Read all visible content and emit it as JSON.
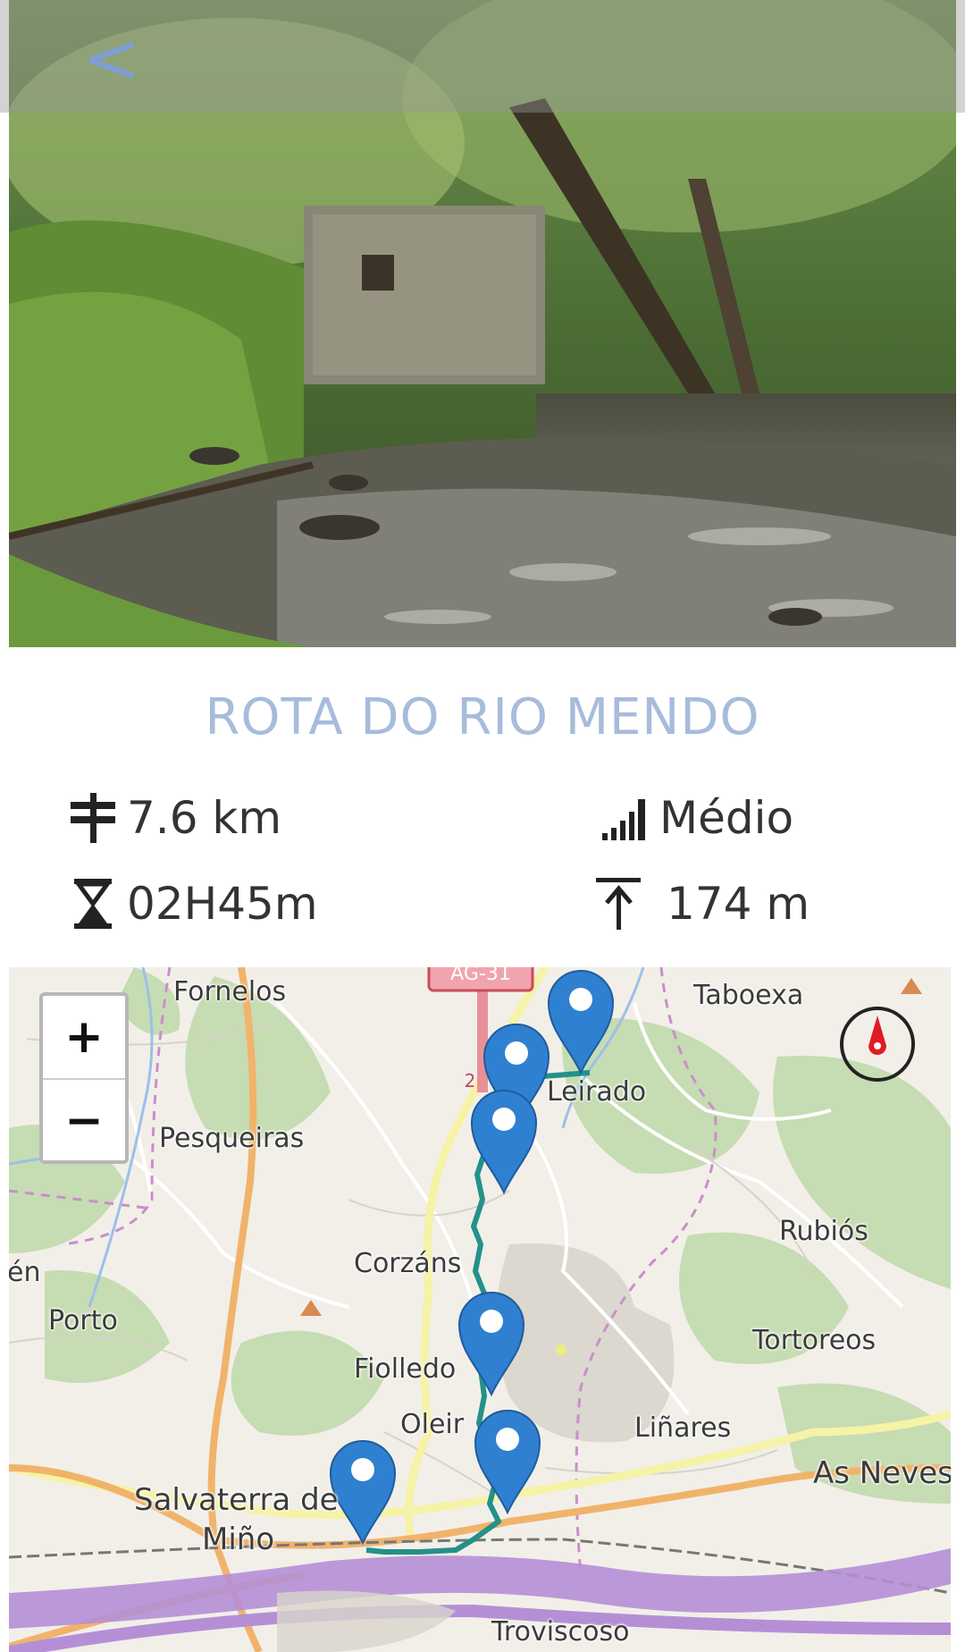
{
  "header": {
    "back_label": "<"
  },
  "route": {
    "title": "ROTA DO RIO MENDO",
    "distance": "7.6 km",
    "difficulty": "Médio",
    "duration": "02H45m",
    "elevation": "174 m"
  },
  "icons": {
    "distance": "signpost-icon",
    "difficulty": "signal-bars-icon",
    "duration": "hourglass-icon",
    "elevation": "ascent-arrow-icon",
    "compass": "compass-icon"
  },
  "map": {
    "zoom_in_label": "+",
    "zoom_out_label": "−",
    "road_sign": "AG-31",
    "road_sign_number": "2",
    "places": [
      "Fornelos",
      "Taboexa",
      "Leirado",
      "Pesqueiras",
      "Rubiós",
      "én",
      "Corzáns",
      "Porto",
      "Tortoreos",
      "Fiolledo",
      "Oleir",
      "Liñares",
      "As Neves",
      "Salvaterra de",
      "Miño",
      "Troviscoso"
    ]
  },
  "colors": {
    "title": "#a7bcdc",
    "back": "#7f9fd4",
    "marker": "#2f80d0",
    "track": "#23918a",
    "river": "#b58fd6"
  }
}
